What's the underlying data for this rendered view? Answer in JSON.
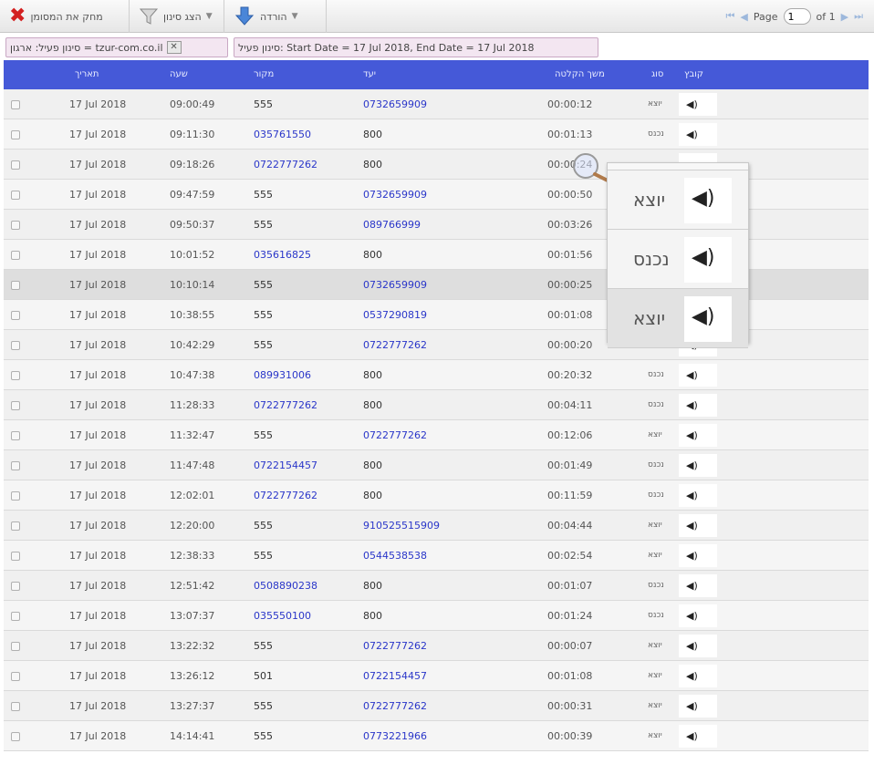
{
  "toolbar": {
    "delete_label": "מחק את המסומן",
    "filter_label": "הצג סינון",
    "download_label": "הורדה"
  },
  "pager": {
    "first": "⏮",
    "prev": "◀",
    "page_label": "Page",
    "page_value": "1",
    "of_label": "of 1",
    "next": "▶",
    "last": "⏭"
  },
  "filters": {
    "org": "סינון פעיל: ארגון = tzur-com.co.il",
    "org_close": "✕",
    "date": "סינון פעיל: Start Date = 17 Jul 2018, End Date = 17 Jul 2018"
  },
  "columns": {
    "date": "תאריך",
    "time": "שעה",
    "source": "מקור",
    "destination": "יעד",
    "duration": "משך הקלטה",
    "type": "סוג",
    "file": "קובץ"
  },
  "icons": {
    "delete": "x-icon",
    "filter": "funnel-icon",
    "download": "download-icon",
    "speaker": "speaker-icon",
    "magnifier": "magnifier-icon"
  },
  "colors": {
    "header_bg": "#4559d8",
    "link": "#2a36c9",
    "delete": "#d31f1f",
    "chip_bg": "#f3e6f1"
  },
  "rows": [
    {
      "date": "17 Jul 2018",
      "time": "09:00:49",
      "source": "555",
      "destination": "0732659909",
      "duration": "00:00:12",
      "type": "יוצא",
      "speaker": "◀)"
    },
    {
      "date": "17 Jul 2018",
      "time": "09:11:30",
      "source": "035761550",
      "destination": "800",
      "duration": "00:01:13",
      "type": "נכנס",
      "speaker": "◀)"
    },
    {
      "date": "17 Jul 2018",
      "time": "09:18:26",
      "source": "0722777262",
      "destination": "800",
      "duration": "00:00:24",
      "type": "",
      "speaker": ""
    },
    {
      "date": "17 Jul 2018",
      "time": "09:47:59",
      "source": "555",
      "destination": "0732659909",
      "duration": "00:00:50",
      "type": "",
      "speaker": ""
    },
    {
      "date": "17 Jul 2018",
      "time": "09:50:37",
      "source": "555",
      "destination": "089766999",
      "duration": "00:03:26",
      "type": "",
      "speaker": ""
    },
    {
      "date": "17 Jul 2018",
      "time": "10:01:52",
      "source": "035616825",
      "destination": "800",
      "duration": "00:01:56",
      "type": "",
      "speaker": ""
    },
    {
      "date": "17 Jul 2018",
      "time": "10:10:14",
      "source": "555",
      "destination": "0732659909",
      "duration": "00:00:25",
      "type": "",
      "speaker": ""
    },
    {
      "date": "17 Jul 2018",
      "time": "10:38:55",
      "source": "555",
      "destination": "0537290819",
      "duration": "00:01:08",
      "type": "",
      "speaker": ""
    },
    {
      "date": "17 Jul 2018",
      "time": "10:42:29",
      "source": "555",
      "destination": "0722777262",
      "duration": "00:00:20",
      "type": "יוצא",
      "speaker": "◀)"
    },
    {
      "date": "17 Jul 2018",
      "time": "10:47:38",
      "source": "089931006",
      "destination": "800",
      "duration": "00:20:32",
      "type": "נכנס",
      "speaker": "◀)"
    },
    {
      "date": "17 Jul 2018",
      "time": "11:28:33",
      "source": "0722777262",
      "destination": "800",
      "duration": "00:04:11",
      "type": "נכנס",
      "speaker": "◀)"
    },
    {
      "date": "17 Jul 2018",
      "time": "11:32:47",
      "source": "555",
      "destination": "0722777262",
      "duration": "00:12:06",
      "type": "יוצא",
      "speaker": "◀)"
    },
    {
      "date": "17 Jul 2018",
      "time": "11:47:48",
      "source": "0722154457",
      "destination": "800",
      "duration": "00:01:49",
      "type": "נכנס",
      "speaker": "◀)"
    },
    {
      "date": "17 Jul 2018",
      "time": "12:02:01",
      "source": "0722777262",
      "destination": "800",
      "duration": "00:11:59",
      "type": "נכנס",
      "speaker": "◀)"
    },
    {
      "date": "17 Jul 2018",
      "time": "12:20:00",
      "source": "555",
      "destination": "910525515909",
      "duration": "00:04:44",
      "type": "יוצא",
      "speaker": "◀)"
    },
    {
      "date": "17 Jul 2018",
      "time": "12:38:33",
      "source": "555",
      "destination": "0544538538",
      "duration": "00:02:54",
      "type": "יוצא",
      "speaker": "◀)"
    },
    {
      "date": "17 Jul 2018",
      "time": "12:51:42",
      "source": "0508890238",
      "destination": "800",
      "duration": "00:01:07",
      "type": "נכנס",
      "speaker": "◀)"
    },
    {
      "date": "17 Jul 2018",
      "time": "13:07:37",
      "source": "035550100",
      "destination": "800",
      "duration": "00:01:24",
      "type": "נכנס",
      "speaker": "◀)"
    },
    {
      "date": "17 Jul 2018",
      "time": "13:22:32",
      "source": "555",
      "destination": "0722777262",
      "duration": "00:00:07",
      "type": "יוצא",
      "speaker": "◀)"
    },
    {
      "date": "17 Jul 2018",
      "time": "13:26:12",
      "source": "501",
      "destination": "0722154457",
      "duration": "00:01:08",
      "type": "יוצא",
      "speaker": "◀)"
    },
    {
      "date": "17 Jul 2018",
      "time": "13:27:37",
      "source": "555",
      "destination": "0722777262",
      "duration": "00:00:31",
      "type": "יוצא",
      "speaker": "◀)"
    },
    {
      "date": "17 Jul 2018",
      "time": "14:14:41",
      "source": "555",
      "destination": "0773221966",
      "duration": "00:00:39",
      "type": "יוצא",
      "speaker": "◀)"
    }
  ],
  "popup": [
    {
      "type": "יוצא",
      "speaker": "◀)"
    },
    {
      "type": "נכנס",
      "speaker": "◀)"
    },
    {
      "type": "יוצא",
      "speaker": "◀)"
    }
  ]
}
